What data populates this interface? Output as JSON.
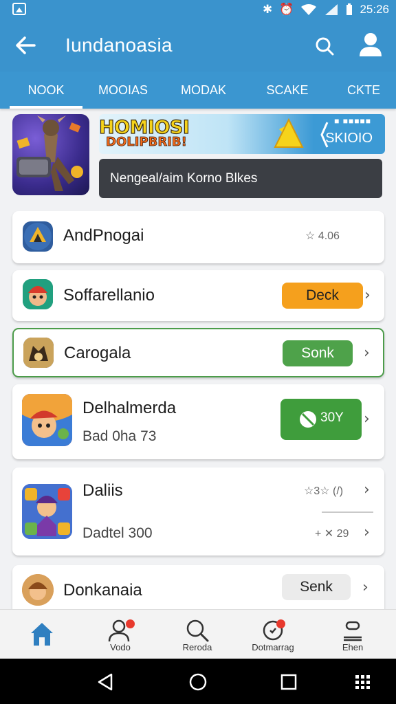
{
  "status": {
    "time": "25:26"
  },
  "appbar": {
    "title": "Iundanoasia"
  },
  "tabs": [
    {
      "label": "NOOK",
      "active": true
    },
    {
      "label": "MOOIAS",
      "active": false
    },
    {
      "label": "MODAK",
      "active": false
    },
    {
      "label": "SCAKE",
      "active": false
    },
    {
      "label": "CKTE",
      "active": false
    }
  ],
  "banner": {
    "promo_title": "HOMIOSI",
    "promo_sub": "DOLIPBRIB!",
    "promo_topline": "■ ■■■■■",
    "promo_price": "SKIOIO",
    "caption": "Nengeal/aim Korno Blkes"
  },
  "list": [
    {
      "name": "AndPnogai",
      "meta": "☆ 4.06"
    },
    {
      "name": "Soffarellanio",
      "button": "Deck",
      "button_color": "#f5a01d"
    },
    {
      "name": "Carogala",
      "button": "Sonk",
      "button_color": "#4ea24a",
      "selected": true
    },
    {
      "name": "Delhalmerda",
      "sub": "Bad 0ha 73",
      "button": "30Y",
      "button_color": "#3f9d3c"
    },
    {
      "name": "Daliis",
      "sub": "Dadtel 300",
      "meta_top": "☆3☆ (/)",
      "meta_bottom": "+ ✕ 29"
    },
    {
      "name": "Donkanaia",
      "button": "Senk",
      "button_color": "#ebebeb"
    }
  ],
  "nav": [
    {
      "label": "",
      "icon": "home-icon",
      "active": true
    },
    {
      "label": "Vodo",
      "icon": "people-icon",
      "badge": true
    },
    {
      "label": "Reroda",
      "icon": "search-icon"
    },
    {
      "label": "Dotmarrag",
      "icon": "notification-icon",
      "badge": true
    },
    {
      "label": "Ehen",
      "icon": "account-icon"
    }
  ],
  "colors": {
    "primary": "#3a93cd",
    "orange": "#f5a01d",
    "green": "#4ea24a",
    "badge": "#e8392d"
  }
}
